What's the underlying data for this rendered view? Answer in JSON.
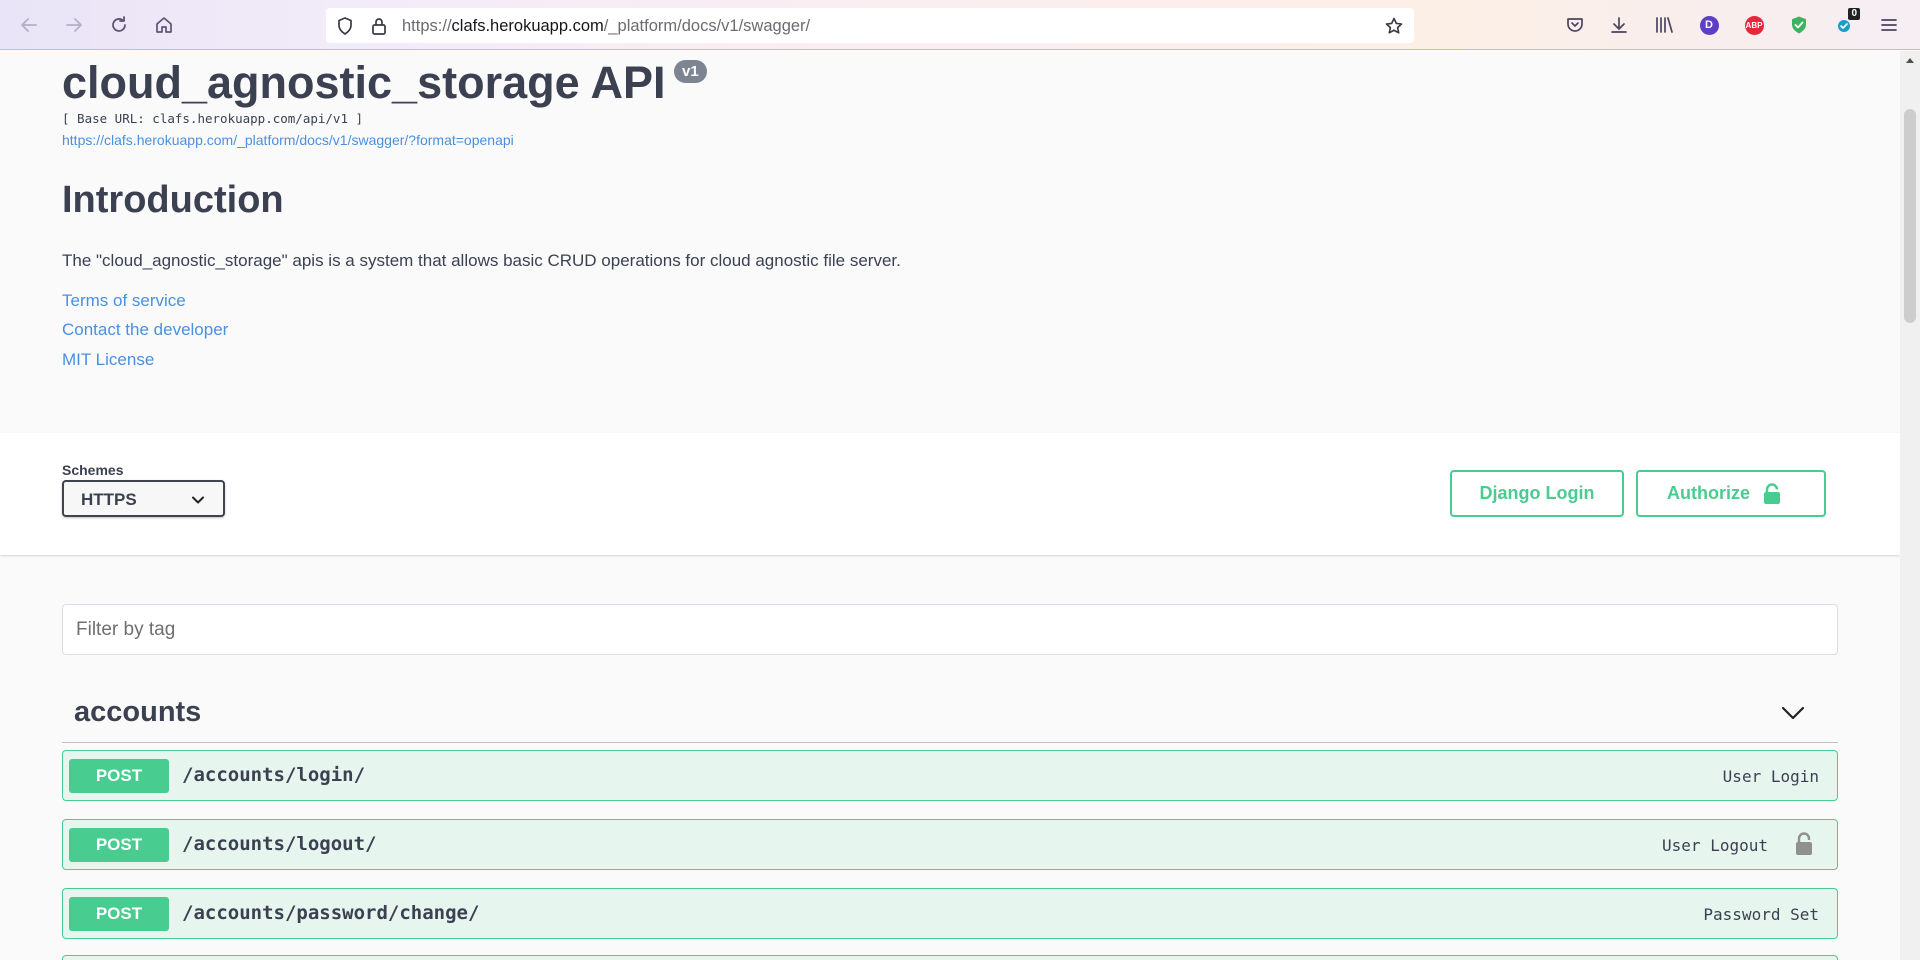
{
  "browser": {
    "url_prefix": "https://",
    "url_host": "clafs.herokuapp.com",
    "url_path": "/_platform/docs/v1/swagger/",
    "account_initial": "D",
    "adblock_label": "ABP",
    "ext_badge_count": "0"
  },
  "info": {
    "title": "cloud_agnostic_storage API",
    "version": "v1",
    "base_url": "[ Base URL: clafs.herokuapp.com/api/v1 ]",
    "spec_link": "https://clafs.herokuapp.com/_platform/docs/v1/swagger/?format=openapi",
    "heading": "Introduction",
    "description": "The \"cloud_agnostic_storage\" apis is a system that allows basic CRUD operations for cloud agnostic file server.",
    "links": {
      "terms": "Terms of service",
      "contact": "Contact the developer",
      "license": "MIT License"
    }
  },
  "schemes": {
    "label": "Schemes",
    "selected": "HTTPS"
  },
  "buttons": {
    "django_login": "Django Login",
    "authorize": "Authorize"
  },
  "filter": {
    "placeholder": "Filter by tag",
    "value": ""
  },
  "tag": {
    "name": "accounts"
  },
  "operations": [
    {
      "method": "POST",
      "path": "/accounts/login/",
      "summary": "User Login",
      "locked": false
    },
    {
      "method": "POST",
      "path": "/accounts/logout/",
      "summary": "User Logout",
      "locked": true
    },
    {
      "method": "POST",
      "path": "/accounts/password/change/",
      "summary": "Password Set",
      "locked": false
    }
  ],
  "colors": {
    "post_green": "#49cc90",
    "link_blue": "#4990e2",
    "text_dark": "#3b4151"
  }
}
